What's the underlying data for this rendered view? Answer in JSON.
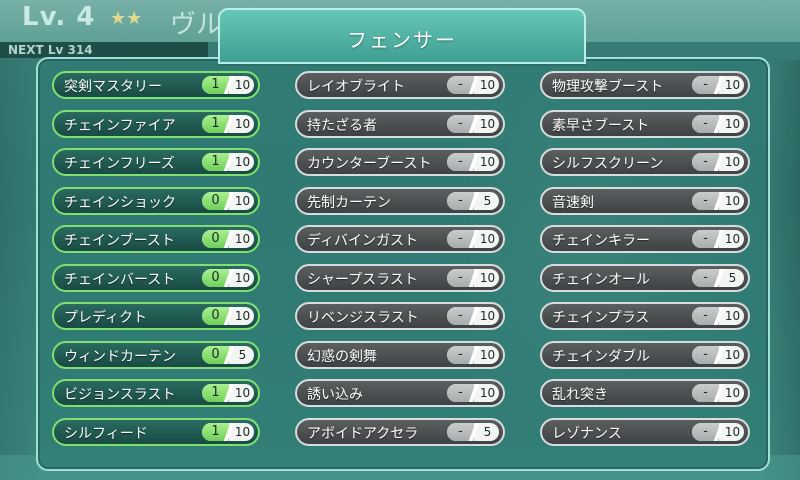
{
  "background": {
    "level": "Lv.  4",
    "stars": "★★",
    "name": "ヴルメール",
    "next": "NEXT Lv 314"
  },
  "panel": {
    "title": "フェンサー",
    "columns": [
      [
        {
          "name": "突剣マスタリー",
          "current": "1",
          "max": "10",
          "learned": true
        },
        {
          "name": "チェインファイア",
          "current": "1",
          "max": "10",
          "learned": true
        },
        {
          "name": "チェインフリーズ",
          "current": "1",
          "max": "10",
          "learned": true
        },
        {
          "name": "チェインショック",
          "current": "0",
          "max": "10",
          "learned": true
        },
        {
          "name": "チェインブースト",
          "current": "0",
          "max": "10",
          "learned": true
        },
        {
          "name": "チェインバースト",
          "current": "0",
          "max": "10",
          "learned": true
        },
        {
          "name": "プレディクト",
          "current": "0",
          "max": "10",
          "learned": true
        },
        {
          "name": "ウィンドカーテン",
          "current": "0",
          "max": "5",
          "learned": true
        },
        {
          "name": "ビジョンスラスト",
          "current": "1",
          "max": "10",
          "learned": true
        },
        {
          "name": "シルフィード",
          "current": "1",
          "max": "10",
          "learned": true
        }
      ],
      [
        {
          "name": "レイオブライト",
          "current": "-",
          "max": "10",
          "learned": false
        },
        {
          "name": "持たざる者",
          "current": "-",
          "max": "10",
          "learned": false
        },
        {
          "name": "カウンターブースト",
          "current": "-",
          "max": "10",
          "learned": false
        },
        {
          "name": "先制カーテン",
          "current": "-",
          "max": "5",
          "learned": false
        },
        {
          "name": "ディバインガスト",
          "current": "-",
          "max": "10",
          "learned": false
        },
        {
          "name": "シャープスラスト",
          "current": "-",
          "max": "10",
          "learned": false
        },
        {
          "name": "リベンジスラスト",
          "current": "-",
          "max": "10",
          "learned": false
        },
        {
          "name": "幻惑の剣舞",
          "current": "-",
          "max": "10",
          "learned": false
        },
        {
          "name": "誘い込み",
          "current": "-",
          "max": "10",
          "learned": false
        },
        {
          "name": "アボイドアクセラ",
          "current": "-",
          "max": "5",
          "learned": false
        }
      ],
      [
        {
          "name": "物理攻撃ブースト",
          "current": "-",
          "max": "10",
          "learned": false
        },
        {
          "name": "素早さブースト",
          "current": "-",
          "max": "10",
          "learned": false
        },
        {
          "name": "シルフスクリーン",
          "current": "-",
          "max": "10",
          "learned": false
        },
        {
          "name": "音速剣",
          "current": "-",
          "max": "10",
          "learned": false
        },
        {
          "name": "チェインキラー",
          "current": "-",
          "max": "10",
          "learned": false
        },
        {
          "name": "チェインオール",
          "current": "-",
          "max": "5",
          "learned": false
        },
        {
          "name": "チェインプラス",
          "current": "-",
          "max": "10",
          "learned": false
        },
        {
          "name": "チェインダブル",
          "current": "-",
          "max": "10",
          "learned": false
        },
        {
          "name": "乱れ突き",
          "current": "-",
          "max": "10",
          "learned": false
        },
        {
          "name": "レゾナンス",
          "current": "-",
          "max": "10",
          "learned": false
        }
      ]
    ]
  }
}
